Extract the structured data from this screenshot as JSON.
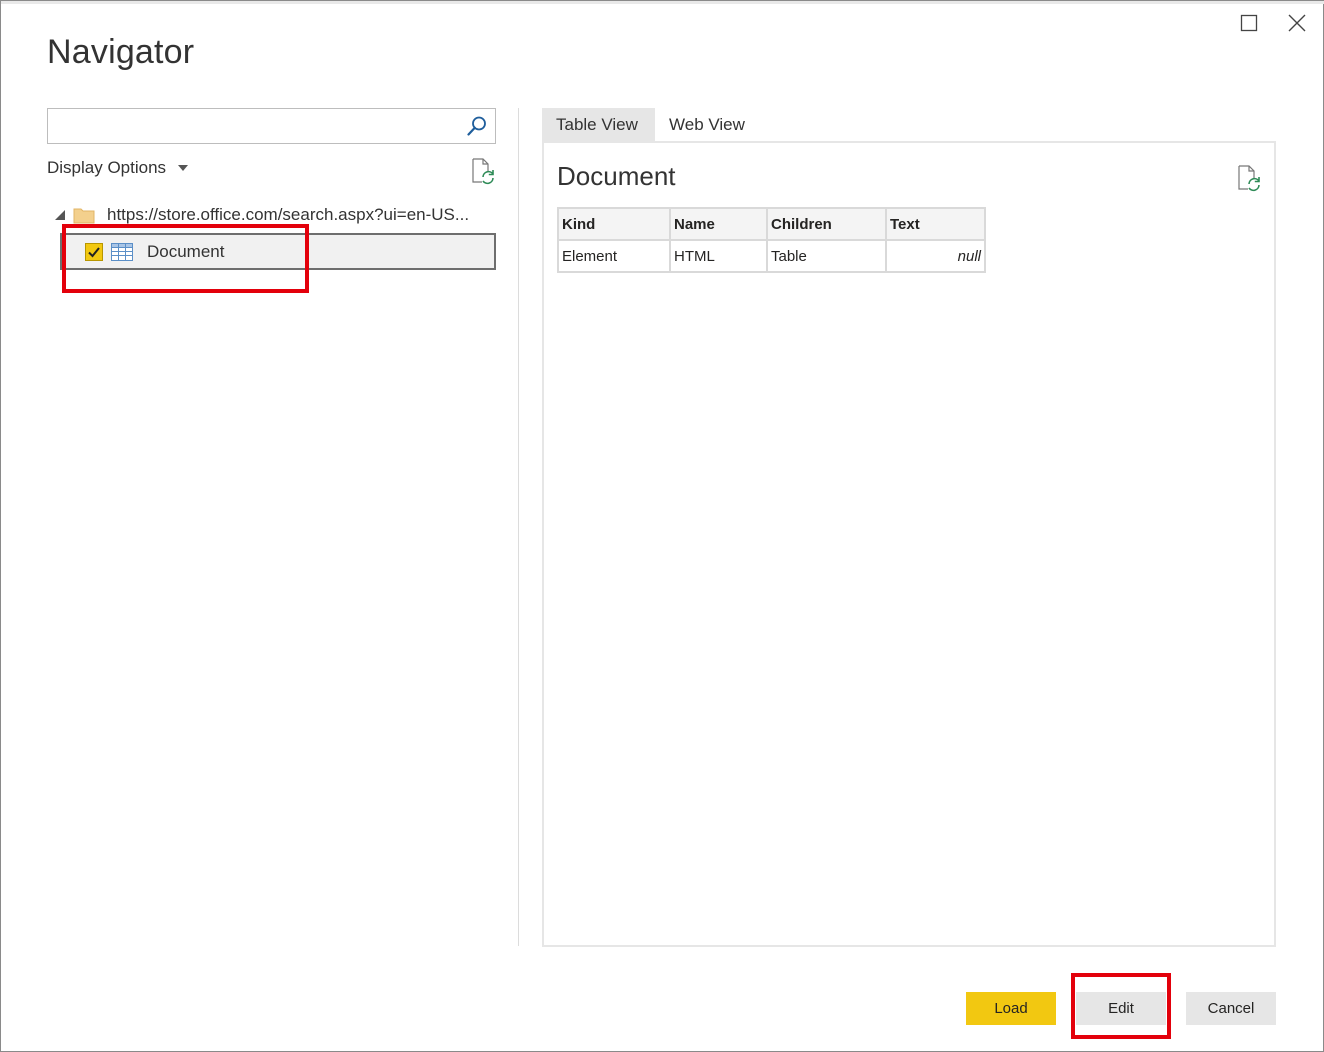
{
  "dialog": {
    "title": "Navigator",
    "window_buttons": [
      "maximize-icon",
      "close-icon"
    ]
  },
  "left_pane": {
    "search": {
      "value": "",
      "placeholder": "",
      "icon": "search-icon"
    },
    "display_options_label": "Display Options",
    "tree": {
      "root_label": "https://store.office.com/search.aspx?ui=en-US...",
      "root_icon": "folder-icon",
      "items": [
        {
          "label": "Document",
          "checked": true,
          "icon": "table-icon"
        }
      ]
    }
  },
  "right_pane": {
    "tabs": [
      {
        "label": "Table View",
        "active": true
      },
      {
        "label": "Web View",
        "active": false
      }
    ],
    "preview_title": "Document",
    "table": {
      "columns": [
        "Kind",
        "Name",
        "Children",
        "Text"
      ],
      "rows": [
        [
          "Element",
          "HTML",
          "Table",
          "null"
        ]
      ]
    }
  },
  "footer": {
    "load_label": "Load",
    "edit_label": "Edit",
    "cancel_label": "Cancel"
  },
  "colors": {
    "accent_yellow": "#f2c811",
    "highlight_red": "#e3000b",
    "button_gray": "#e6e6e6"
  }
}
